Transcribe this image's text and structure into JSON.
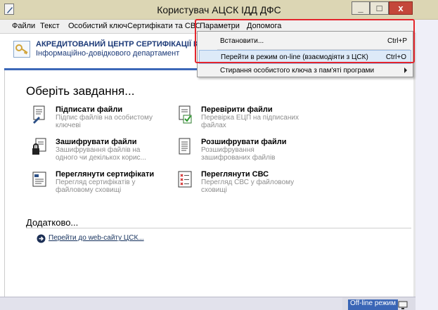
{
  "window": {
    "title": "Користувач АЦСК ІДД ДФС",
    "minimize_symbol": "_",
    "maximize_symbol": "□",
    "close_symbol": "x"
  },
  "menubar": {
    "items": [
      {
        "label": "Файли"
      },
      {
        "label": "Текст"
      },
      {
        "label": "Особистий ключ"
      },
      {
        "label": "Сертифікати та СВС"
      },
      {
        "label": "Параметри"
      },
      {
        "label": "Допомога"
      }
    ]
  },
  "banner": {
    "line1": "АКРЕДИТОВАНИЙ ЦЕНТР СЕРТИФІКАЦІЇ К",
    "line2": "Інформаційно-довідкового департамент"
  },
  "main": {
    "heading": "Оберіть завдання...",
    "tasks": [
      {
        "title": "Підписати файли",
        "description": "Підпис файлів на особистому ключеві",
        "icon": "sign-document-icon"
      },
      {
        "title": "Перевірити файли",
        "description": "Перевірка ЕЦП на підписаних файлах",
        "icon": "verify-document-icon"
      },
      {
        "title": "Зашифрувати файли",
        "description": "Зашифрування файлів на одного чи декількох корис...",
        "icon": "encrypt-document-icon"
      },
      {
        "title": "Розшифрувати файли",
        "description": "Розшифрування зашифрованих файлів",
        "icon": "decrypt-document-icon"
      },
      {
        "title": "Переглянути сертифікати",
        "description": "Перегляд сертифікатів у файловому сховищі",
        "icon": "certificate-icon"
      },
      {
        "title": "Переглянути СВС",
        "description": "Перегляд СВС у файловому сховищі",
        "icon": "revocation-list-icon"
      }
    ],
    "extra_heading": "Додатково...",
    "web_link": "Перейти до web-сайту ЦСК..."
  },
  "statusbar": {
    "mode": "Off-line режим"
  },
  "dropdown": {
    "items": [
      {
        "label": "Встановити...",
        "shortcut": "Ctrl+P"
      },
      {
        "label": "Перейти в режим on-line (взаємодіяти з ЦСК)",
        "shortcut": "Ctrl+O"
      },
      {
        "label": "Стирання особистого ключа з пам'яті програми",
        "shortcut": ""
      }
    ]
  },
  "colors": {
    "accent": "#3c68b8",
    "highlight_box": "#e4252d",
    "titlebar": "#dcd6b4",
    "close_button": "#c4473a"
  }
}
